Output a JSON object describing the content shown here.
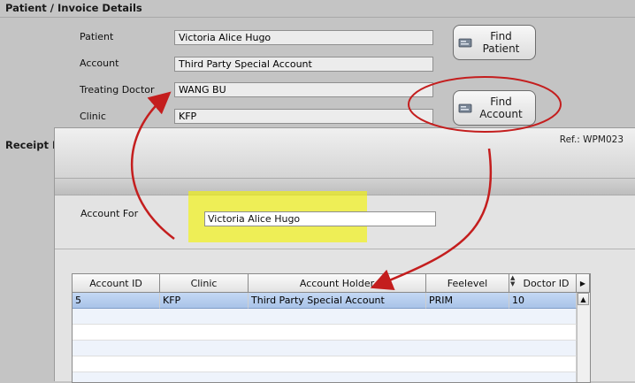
{
  "section_title": "Patient / Invoice Details",
  "fields": [
    {
      "label": "Patient",
      "value": "Victoria Alice Hugo"
    },
    {
      "label": "Account",
      "value": "Third Party Special Account"
    },
    {
      "label": "Treating Doctor",
      "value": "WANG BU"
    },
    {
      "label": "Clinic",
      "value": "KFP"
    }
  ],
  "buttons": {
    "find_patient": "Find\nPatient",
    "find_account": "Find\nAccount"
  },
  "receipt_label": "Receipt I",
  "dialog": {
    "ref": "Ref.: WPM023",
    "account_for_label": "Account For",
    "account_for_value": "Victoria Alice Hugo"
  },
  "grid": {
    "columns": [
      "Account ID",
      "Clinic",
      "Account Holder",
      "Feelevel",
      "Doctor ID"
    ],
    "rows": [
      [
        "5",
        "KFP",
        "Third Party Special Account",
        "PRIM",
        "10"
      ]
    ]
  },
  "colors": {
    "annotation": "#c41e1e",
    "highlight": "#f5f500",
    "selected_row": "#b8cdee"
  },
  "icons": [
    "patient-card-icon",
    "account-card-icon",
    "sort-icon",
    "scroll-right-icon",
    "scroll-up-icon"
  ]
}
